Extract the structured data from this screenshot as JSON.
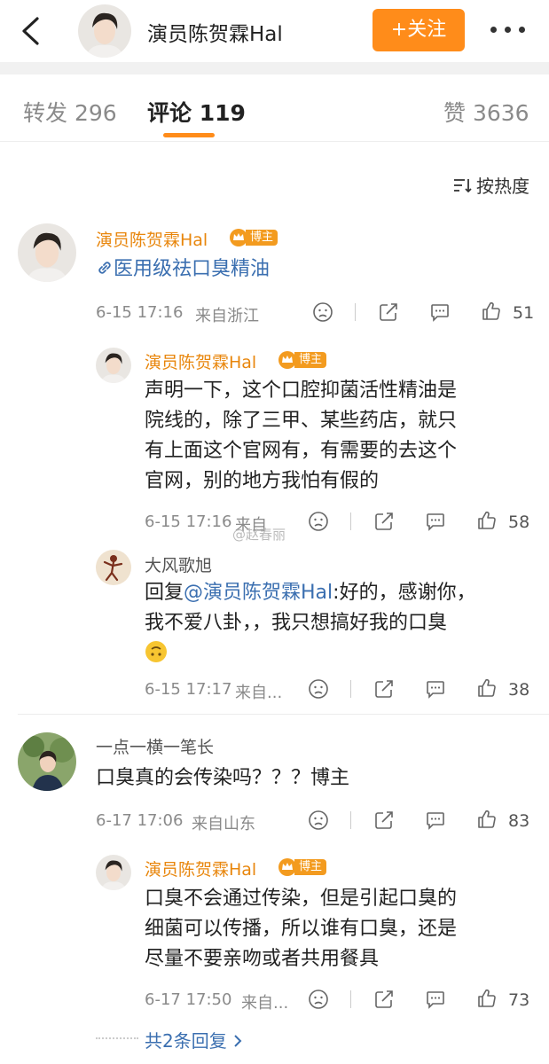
{
  "header": {
    "name": "演员陈贺霖Hal",
    "follow_label": "+关注"
  },
  "tabs": [
    {
      "label": "转发 296"
    },
    {
      "label": "评论 119"
    },
    {
      "label": "赞 3636"
    }
  ],
  "sort_label": "按热度",
  "comments": [
    {
      "author": "演员陈贺霖Hal",
      "badge": "博主",
      "text": "医用级祛口臭精油",
      "time": "6-15 17:16",
      "location": "来自浙江",
      "likes": "51"
    },
    {
      "author": "演员陈贺霖Hal",
      "badge": "博主",
      "text_lines": [
        "声明一下，这个口腔抑菌活性精油是",
        "院线的，除了三甲、某些药店，就只",
        "有上面这个官网有，有需要的去这个",
        "官网，别的地方我怕有假的"
      ],
      "time": "6-15 17:16",
      "location": "来自",
      "likes": "58"
    },
    {
      "author": "大风歌旭",
      "reply_prefix": "回复",
      "mention": "@演员陈贺霖Hal",
      "text_lines": [
        ":好的，感谢你，",
        "我不爱八卦，，我只想搞好我的口臭"
      ],
      "time": "6-15 17:17",
      "location": "来自...",
      "likes": "38"
    },
    {
      "author": "一点一横一笔长",
      "text": "口臭真的会传染吗？？？博主",
      "time": "6-17 17:06",
      "location": "来自山东",
      "likes": "83"
    },
    {
      "author": "演员陈贺霖Hal",
      "badge": "博主",
      "text_lines": [
        "口臭不会通过传染，但是引起口臭的",
        "细菌可以传播，所以谁有口臭，还是",
        "尽量不要亲吻或者共用餐具"
      ],
      "time": "6-17 17:50",
      "location": "来自...",
      "likes": "73"
    }
  ],
  "more_replies": "共2条回复",
  "watermark": "@赵春丽",
  "colors": {
    "accent": "#ff8c1a",
    "link": "#3b6fb0",
    "username": "#e8860c"
  }
}
